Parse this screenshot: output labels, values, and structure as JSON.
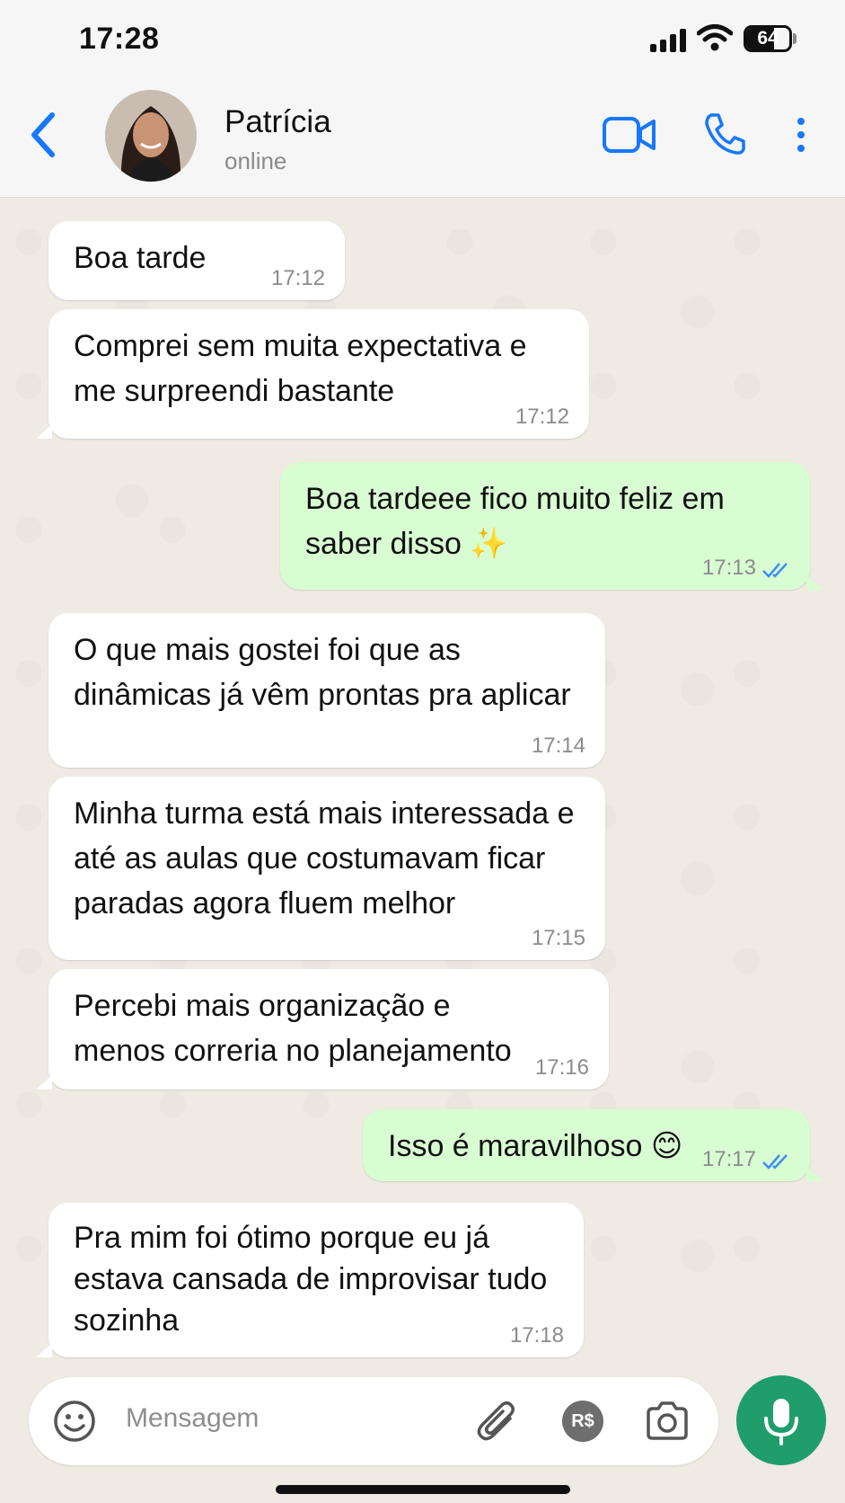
{
  "status_bar": {
    "time": "17:28",
    "battery": "64",
    "battery_level": 0.64
  },
  "header": {
    "name": "Patrícia",
    "status": "online"
  },
  "messages": [
    {
      "dir": "in",
      "text": "Boa tarde",
      "time": "17:12"
    },
    {
      "dir": "in",
      "text": "Comprei sem muita expectativa e me surpreendi bastante",
      "time": "17:12"
    },
    {
      "dir": "out",
      "text": "Boa tardeee fico muito feliz em saber disso ✨",
      "time": "17:13",
      "status": "read"
    },
    {
      "dir": "in",
      "text": "O que mais gostei foi que as dinâmicas já vêm prontas pra aplicar",
      "time": "17:14"
    },
    {
      "dir": "in",
      "text": "Minha turma está mais interessada e até as aulas que costumavam ficar paradas agora fluem melhor",
      "time": "17:15"
    },
    {
      "dir": "in",
      "text": "Percebi mais organização e menos correria no planejamento",
      "time": "17:16"
    },
    {
      "dir": "out",
      "text": "Isso é maravilhoso 😊",
      "time": "17:17",
      "status": "read"
    },
    {
      "dir": "in",
      "text": "Pra mim foi ótimo porque eu já estava cansada de improvisar tudo sozinha",
      "time": "17:18"
    }
  ],
  "composer": {
    "placeholder": "Mensagem",
    "payment_label": "R$"
  },
  "colors": {
    "accent": "#1677ff",
    "incoming": "#ffffff",
    "outgoing": "#d9fdd3",
    "mic": "#1f9e6b",
    "read_ticks": "#3b8ef0"
  }
}
